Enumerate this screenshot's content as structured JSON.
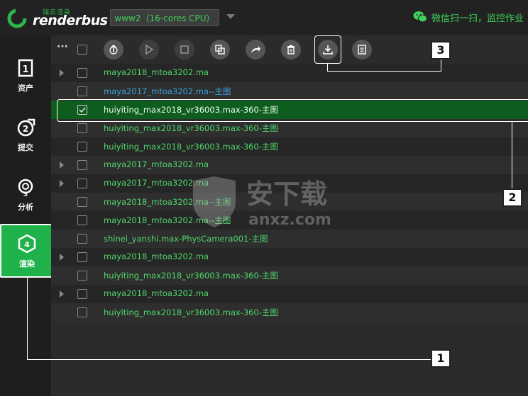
{
  "brand": {
    "cn": "瑞云渲染",
    "en": "renderbus"
  },
  "cpu_select": {
    "value": "www2（16-cores CPU）"
  },
  "wechat": {
    "text": "微信扫一扫，监控作业"
  },
  "sidebar": {
    "items": [
      {
        "num": "1",
        "label": "资产",
        "icon": "assets-icon"
      },
      {
        "num": "2",
        "label": "提交",
        "icon": "submit-icon"
      },
      {
        "num": "3",
        "label": "分析",
        "icon": "analyze-icon"
      },
      {
        "num": "4",
        "label": "渲染",
        "icon": "render-icon",
        "active": true
      }
    ]
  },
  "toolbar": {
    "more": "···",
    "buttons": [
      "upload-icon",
      "play-icon",
      "stop-icon",
      "copy-icon",
      "redo-icon",
      "delete-icon",
      "download-icon",
      "log-icon"
    ]
  },
  "rows": [
    {
      "name": "maya2018_mtoa3202.ma",
      "expandable": true
    },
    {
      "name": "maya2017_mtoa3202.ma--主图",
      "expandable": false,
      "color": "blue"
    },
    {
      "name": "huiyiting_max2018_vr36003.max-360-主图",
      "expandable": false,
      "selected": true
    },
    {
      "name": "huiyiting_max2018_vr36003.max-360-主图",
      "expandable": false
    },
    {
      "name": "huiyiting_max2018_vr36003.max-360-主图",
      "expandable": false
    },
    {
      "name": "maya2017_mtoa3202.ma",
      "expandable": true
    },
    {
      "name": "maya2017_mtoa3202.ma",
      "expandable": true
    },
    {
      "name": "maya2018_mtoa3202.ma--主图",
      "expandable": false
    },
    {
      "name": "maya2018_mtoa3202.ma--主图",
      "expandable": false
    },
    {
      "name": "shinei_yanshi.max-PhysCamera001-主图",
      "expandable": false
    },
    {
      "name": "maya2018_mtoa3202.ma",
      "expandable": true
    },
    {
      "name": "huiyiting_max2018_vr36003.max-360-主图",
      "expandable": false
    },
    {
      "name": "maya2018_mtoa3202.ma",
      "expandable": true
    },
    {
      "name": "huiyiting_max2018_vr36003.max-360-主图",
      "expandable": false
    }
  ],
  "callouts": {
    "c1": "1",
    "c2": "2",
    "c3": "3"
  },
  "watermark": {
    "cn": "安下载",
    "en": "anxz.com"
  },
  "colors": {
    "accent": "#1fb24a",
    "text_green": "#4fd86a",
    "text_blue": "#3aa0dc",
    "selected_row": "#0f5c1f"
  }
}
